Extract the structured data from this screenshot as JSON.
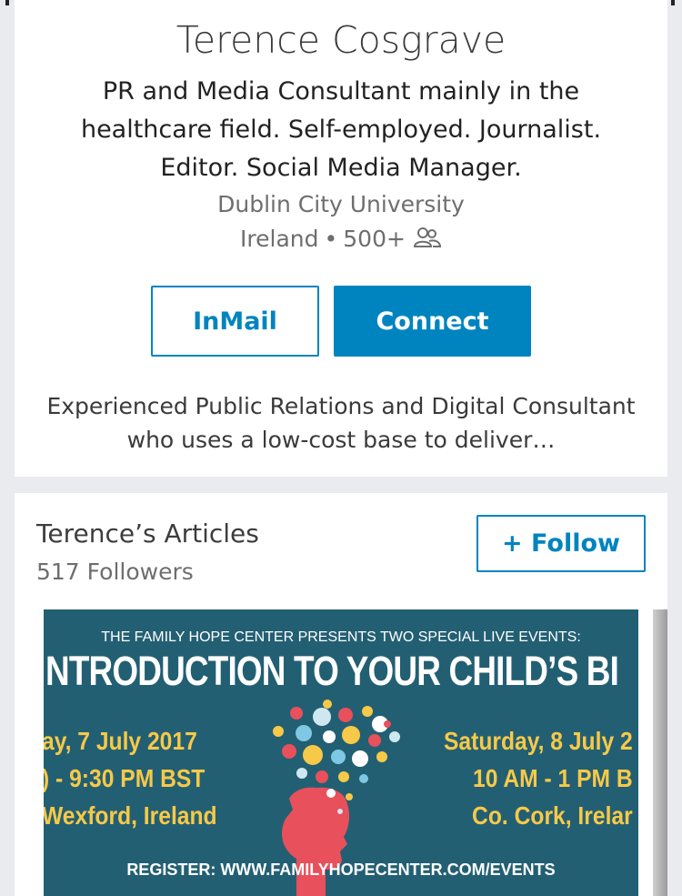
{
  "profile": {
    "name": "Terence Cosgrave",
    "headline": "PR and Media Consultant mainly in the healthcare field. Self-employed. Journalist. Editor. Social Media Manager.",
    "school": "Dublin City University",
    "location": "Ireland",
    "separator": "•",
    "connections": "500+",
    "connections_icon": "people-icon",
    "inmail_label": "InMail",
    "connect_label": "Connect",
    "summary": "Experienced Public Relations and Digital Consultant who uses a low-cost base to deliver…"
  },
  "articles": {
    "title": "Terence’s Articles",
    "followers": "517 Followers",
    "follow_label": "+ Follow",
    "image": {
      "top_line": "THE FAMILY HOPE CENTER PRESENTS TWO SPECIAL LIVE EVENTS:",
      "headline": "NTRODUCTION TO YOUR CHILD’S BI",
      "left_lines": [
        "ay,  7 July 2017",
        ") - 9:30 PM BST",
        "Wexford, Ireland"
      ],
      "right_lines": [
        "Saturday,  8 July 2",
        "10 AM - 1 PM B",
        "Co. Cork, Irelar"
      ],
      "register": "REGISTER: WWW.FAMILYHOPECENTER.COM/EVENTS"
    }
  },
  "colors": {
    "accent": "#0084bf",
    "background": "#e9ebee",
    "image_background": "#235f73",
    "image_highlight": "#f7c948"
  }
}
